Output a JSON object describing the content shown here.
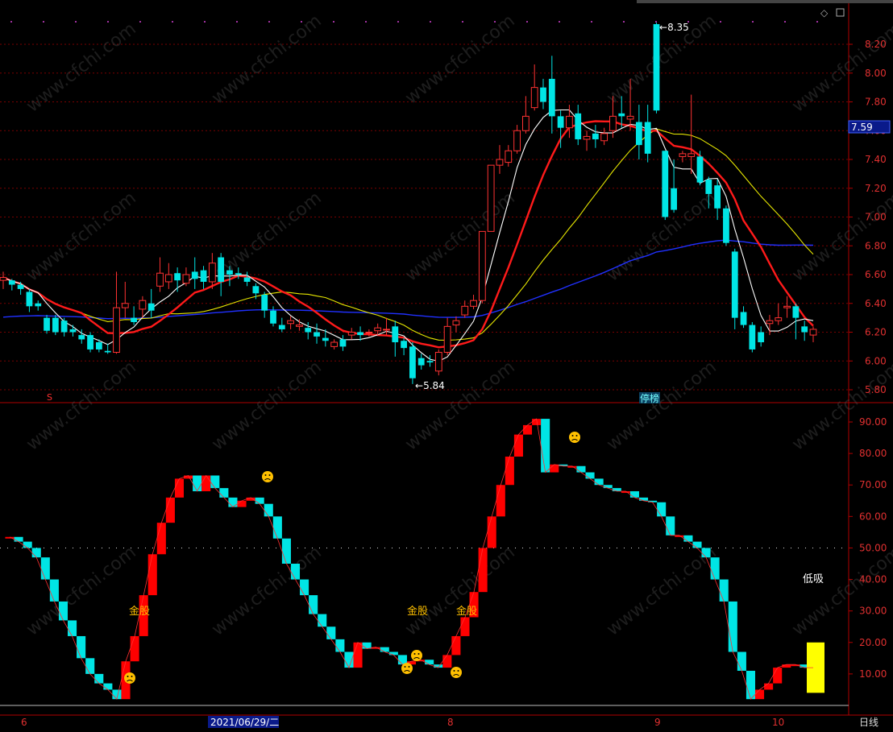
{
  "chart_data": [
    {
      "type": "candlestick",
      "price_axis": {
        "ticks": [
          5.8,
          6.0,
          6.2,
          6.4,
          6.6,
          6.8,
          7.0,
          7.2,
          7.4,
          7.6,
          7.8,
          8.0,
          8.2
        ],
        "ylim": [
          5.74,
          8.44
        ]
      },
      "current_price": "7.59",
      "annotations": {
        "high": "8.35",
        "low": "5.84",
        "tag": "停榜",
        "s_marker": "S"
      },
      "colors": {
        "up": "#ff3232",
        "down": "#00e5e5",
        "ma5": "#ffffff",
        "ma10": "#ff1a1a",
        "ma20": "#e6e600",
        "ma60": "#2030ff"
      },
      "candles": [
        [
          6.56,
          6.62,
          6.58,
          6.5
        ],
        [
          6.56,
          6.57,
          6.53,
          6.49
        ],
        [
          6.53,
          6.55,
          6.5,
          6.46
        ],
        [
          6.48,
          6.5,
          6.38,
          6.34
        ],
        [
          6.4,
          6.42,
          6.38,
          6.35
        ],
        [
          6.3,
          6.32,
          6.21,
          6.19
        ],
        [
          6.3,
          6.32,
          6.2,
          6.18
        ],
        [
          6.28,
          6.3,
          6.2,
          6.17
        ],
        [
          6.22,
          6.25,
          6.2,
          6.17
        ],
        [
          6.18,
          6.22,
          6.15,
          6.12
        ],
        [
          6.18,
          6.2,
          6.08,
          6.06
        ],
        [
          6.13,
          6.15,
          6.08,
          6.06
        ],
        [
          6.07,
          6.12,
          6.06,
          6.05
        ],
        [
          6.06,
          6.62,
          6.37,
          6.05
        ],
        [
          6.37,
          6.55,
          6.4,
          6.3
        ],
        [
          6.3,
          6.38,
          6.27,
          6.25
        ],
        [
          6.36,
          6.45,
          6.42,
          6.3
        ],
        [
          6.4,
          6.5,
          6.35,
          6.3
        ],
        [
          6.52,
          6.72,
          6.61,
          6.48
        ],
        [
          6.55,
          6.68,
          6.6,
          6.5
        ],
        [
          6.61,
          6.65,
          6.56,
          6.48
        ],
        [
          6.54,
          6.65,
          6.6,
          6.52
        ],
        [
          6.62,
          6.72,
          6.57,
          6.5
        ],
        [
          6.63,
          6.66,
          6.55,
          6.5
        ],
        [
          6.55,
          6.75,
          6.68,
          6.5
        ],
        [
          6.72,
          6.75,
          6.55,
          6.45
        ],
        [
          6.63,
          6.66,
          6.6,
          6.52
        ],
        [
          6.61,
          6.65,
          6.6,
          6.57
        ],
        [
          6.58,
          6.62,
          6.55,
          6.52
        ],
        [
          6.52,
          6.54,
          6.47,
          6.43
        ],
        [
          6.46,
          6.48,
          6.35,
          6.3
        ],
        [
          6.35,
          6.38,
          6.26,
          6.24
        ],
        [
          6.25,
          6.3,
          6.22,
          6.2
        ],
        [
          6.26,
          6.31,
          6.28,
          6.22
        ],
        [
          6.24,
          6.29,
          6.25,
          6.21
        ],
        [
          6.23,
          6.27,
          6.2,
          6.15
        ],
        [
          6.2,
          6.26,
          6.17,
          6.12
        ],
        [
          6.16,
          6.22,
          6.14,
          6.1
        ],
        [
          6.1,
          6.15,
          6.13,
          6.08
        ],
        [
          6.15,
          6.18,
          6.1,
          6.07
        ],
        [
          6.18,
          6.23,
          6.2,
          6.15
        ],
        [
          6.2,
          6.24,
          6.18,
          6.14
        ],
        [
          6.2,
          6.22,
          6.2,
          6.17
        ],
        [
          6.21,
          6.26,
          6.23,
          6.18
        ],
        [
          6.22,
          6.3,
          6.22,
          6.18
        ],
        [
          6.24,
          6.28,
          6.13,
          6.03
        ],
        [
          6.14,
          6.16,
          6.09,
          6.04
        ],
        [
          6.1,
          6.13,
          5.88,
          5.84
        ],
        [
          6.02,
          6.05,
          5.97,
          5.94
        ],
        [
          6.0,
          6.04,
          5.99,
          5.96
        ],
        [
          5.93,
          6.08,
          6.06,
          5.9
        ],
        [
          6.06,
          6.3,
          6.24,
          6.04
        ],
        [
          6.25,
          6.31,
          6.28,
          6.2
        ],
        [
          6.32,
          6.42,
          6.38,
          6.3
        ],
        [
          6.38,
          6.46,
          6.42,
          6.36
        ],
        [
          6.42,
          6.9,
          6.9,
          6.4
        ],
        [
          6.9,
          7.32,
          7.36,
          6.9
        ],
        [
          7.36,
          7.5,
          7.4,
          7.3
        ],
        [
          7.38,
          7.5,
          7.46,
          7.35
        ],
        [
          7.46,
          7.64,
          7.6,
          7.44
        ],
        [
          7.6,
          7.84,
          7.7,
          7.58
        ],
        [
          7.76,
          8.06,
          7.9,
          7.74
        ],
        [
          7.9,
          7.96,
          7.8,
          7.75
        ],
        [
          7.96,
          8.12,
          7.7,
          7.58
        ],
        [
          7.7,
          7.74,
          7.62,
          7.48
        ],
        [
          7.62,
          7.78,
          7.7,
          7.55
        ],
        [
          7.72,
          7.78,
          7.54,
          7.5
        ],
        [
          7.54,
          7.6,
          7.56,
          7.46
        ],
        [
          7.58,
          7.64,
          7.54,
          7.48
        ],
        [
          7.53,
          7.62,
          7.58,
          7.5
        ],
        [
          7.6,
          7.84,
          7.7,
          7.55
        ],
        [
          7.72,
          7.84,
          7.7,
          7.62
        ],
        [
          7.68,
          7.96,
          7.7,
          7.6
        ],
        [
          7.66,
          7.78,
          7.5,
          7.4
        ],
        [
          7.66,
          7.78,
          7.44,
          7.38
        ],
        [
          8.34,
          8.35,
          7.74,
          7.72
        ],
        [
          7.46,
          7.46,
          7.0,
          6.98
        ],
        [
          7.2,
          7.4,
          7.05,
          7.03
        ],
        [
          7.42,
          7.46,
          7.44,
          7.38
        ],
        [
          7.42,
          7.85,
          7.44,
          7.3
        ],
        [
          7.42,
          7.46,
          7.24,
          7.22
        ],
        [
          7.26,
          7.28,
          7.16,
          7.06
        ],
        [
          7.22,
          7.26,
          7.06,
          6.98
        ],
        [
          7.06,
          7.08,
          6.82,
          6.8
        ],
        [
          6.76,
          6.78,
          6.3,
          6.22
        ],
        [
          6.34,
          6.38,
          6.25,
          6.23
        ],
        [
          6.25,
          6.27,
          6.08,
          6.06
        ],
        [
          6.2,
          6.24,
          6.13,
          6.1
        ],
        [
          6.26,
          6.32,
          6.28,
          6.18
        ],
        [
          6.28,
          6.4,
          6.3,
          6.25
        ],
        [
          6.37,
          6.45,
          6.38,
          6.3
        ],
        [
          6.38,
          6.4,
          6.3,
          6.15
        ],
        [
          6.24,
          6.28,
          6.2,
          6.14
        ],
        [
          6.18,
          6.24,
          6.22,
          6.13
        ]
      ],
      "xlabels": [
        "6",
        "2021/06/29/二",
        "8",
        "9",
        "10"
      ],
      "period": "日线"
    },
    {
      "type": "bar",
      "axis": {
        "ticks": [
          10.0,
          20.0,
          30.0,
          40.0,
          50.0,
          60.0,
          70.0,
          80.0,
          90.0
        ],
        "ylim": [
          0,
          93
        ]
      },
      "bars": [
        [
          53.5,
          53.5
        ],
        [
          53.5,
          52
        ],
        [
          52,
          50
        ],
        [
          50,
          47
        ],
        [
          47,
          40
        ],
        [
          40,
          33
        ],
        [
          33,
          27
        ],
        [
          27,
          22
        ],
        [
          22,
          15
        ],
        [
          15,
          10
        ],
        [
          10,
          7
        ],
        [
          7,
          5
        ],
        [
          5,
          2
        ],
        [
          2,
          14
        ],
        [
          14,
          22
        ],
        [
          22,
          35
        ],
        [
          35,
          48
        ],
        [
          48,
          58
        ],
        [
          58,
          66
        ],
        [
          66,
          72
        ],
        [
          72,
          73
        ],
        [
          73,
          68
        ],
        [
          68,
          73
        ],
        [
          73,
          69
        ],
        [
          69,
          66
        ],
        [
          66,
          63
        ],
        [
          63,
          65
        ],
        [
          65,
          66
        ],
        [
          66,
          64
        ],
        [
          64,
          60
        ],
        [
          60,
          53
        ],
        [
          53,
          45
        ],
        [
          45,
          40
        ],
        [
          40,
          35
        ],
        [
          35,
          29
        ],
        [
          29,
          25
        ],
        [
          25,
          21
        ],
        [
          21,
          17
        ],
        [
          17,
          12
        ],
        [
          12,
          20
        ],
        [
          20,
          18
        ],
        [
          18,
          18.5
        ],
        [
          18.5,
          17
        ],
        [
          17,
          16
        ],
        [
          16,
          13
        ],
        [
          13,
          14
        ],
        [
          14,
          14.5
        ],
        [
          14.5,
          13
        ],
        [
          13,
          12
        ],
        [
          12,
          16
        ],
        [
          16,
          22
        ],
        [
          22,
          28
        ],
        [
          28,
          36
        ],
        [
          36,
          50
        ],
        [
          50,
          60
        ],
        [
          60,
          70
        ],
        [
          70,
          79
        ],
        [
          79,
          86
        ],
        [
          86,
          89
        ],
        [
          89,
          91
        ],
        [
          91,
          74
        ],
        [
          74,
          76.5
        ],
        [
          76.5,
          76
        ],
        [
          76,
          76
        ],
        [
          76,
          74
        ],
        [
          74,
          72
        ],
        [
          72,
          70
        ],
        [
          70,
          69
        ],
        [
          69,
          68
        ],
        [
          68,
          68
        ],
        [
          68,
          66
        ],
        [
          66,
          65
        ],
        [
          65,
          64.5
        ],
        [
          64.5,
          60
        ],
        [
          60,
          54
        ],
        [
          54,
          54
        ],
        [
          54,
          52
        ],
        [
          52,
          50
        ],
        [
          50,
          47
        ],
        [
          47,
          40
        ],
        [
          40,
          33
        ],
        [
          33,
          17
        ],
        [
          17,
          11
        ],
        [
          11,
          2
        ],
        [
          2,
          5
        ],
        [
          5,
          7
        ],
        [
          7,
          12
        ],
        [
          12,
          13
        ],
        [
          13,
          13
        ],
        [
          13,
          12
        ],
        [
          12,
          12
        ]
      ],
      "marker_bar": [
        20,
        4
      ],
      "labels": {
        "gold1": "金股",
        "gold2": "金股",
        "gold3": "金股",
        "dip": "低吸"
      },
      "colors": {
        "up": "#ff0000",
        "down": "#00e5e5",
        "marker": "#ffff00"
      }
    }
  ],
  "watermark": "www.cfchi.com"
}
